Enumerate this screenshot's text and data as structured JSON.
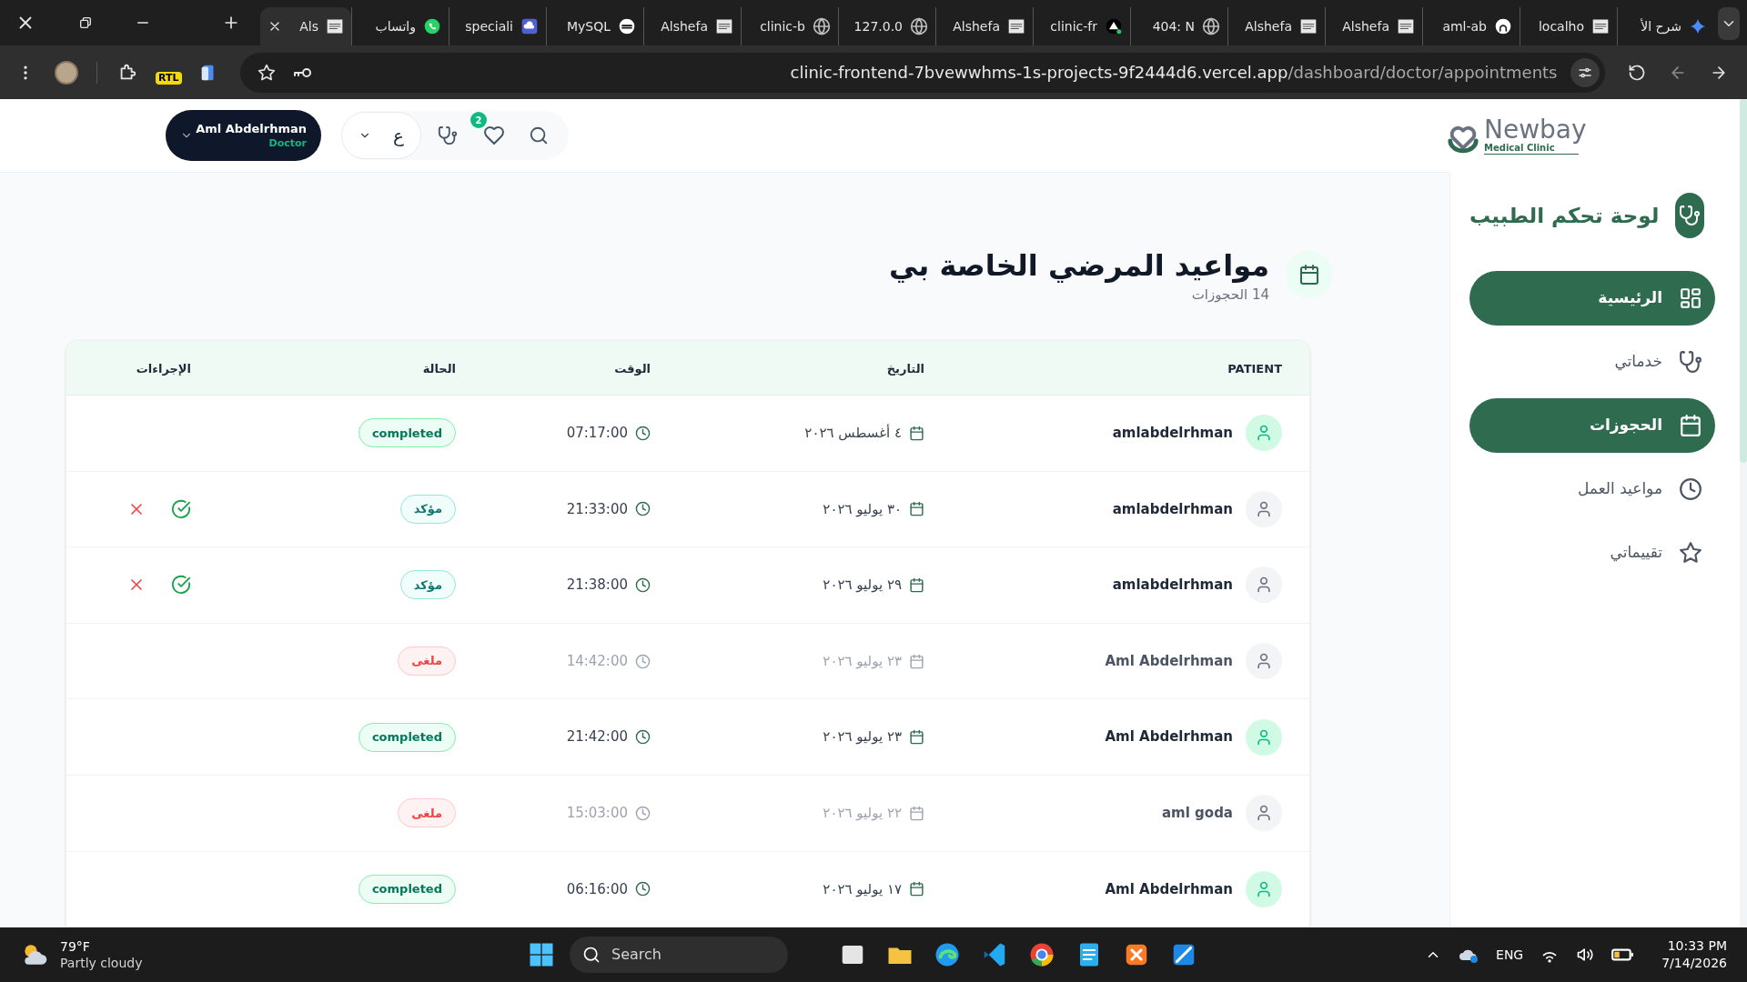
{
  "browser": {
    "tabs": [
      {
        "label": "شرح الأ",
        "selected": false
      },
      {
        "label": "localho",
        "selected": false
      },
      {
        "label": "aml-ab",
        "selected": false
      },
      {
        "label": "Alshefa",
        "selected": false
      },
      {
        "label": "Alshefa",
        "selected": false
      },
      {
        "label": "404: N",
        "selected": false
      },
      {
        "label": "clinic-fr",
        "selected": false
      },
      {
        "label": "Alshefa",
        "selected": false
      },
      {
        "label": "127.0.0",
        "selected": false
      },
      {
        "label": "clinic-b",
        "selected": false
      },
      {
        "label": "Alshefa",
        "selected": false
      },
      {
        "label": "MySQL",
        "selected": false
      },
      {
        "label": "speciali",
        "selected": false
      },
      {
        "label": "واتساب",
        "selected": false
      },
      {
        "label": "Als",
        "selected": true
      }
    ],
    "extension_badge": "RTL",
    "url": {
      "host": "clinic-frontend-7bvewwhms-1s-projects-9f2444d6.vercel.app",
      "path": "/dashboard/doctor/appointments"
    }
  },
  "header": {
    "logo": {
      "name": "Newbay",
      "tagline": "Medical Clinic"
    },
    "user": {
      "name": "Aml Abdelrhman",
      "role": "Doctor"
    },
    "language": "ع",
    "favorites_badge": "2"
  },
  "sidebar": {
    "title": "لوحة تحكم الطبيب",
    "items": [
      {
        "label": "الرئيسية",
        "selected": true
      },
      {
        "label": "خدماتي",
        "selected": false
      },
      {
        "label": "الحجوزات",
        "selected": true
      },
      {
        "label": "مواعيد العمل",
        "selected": false
      },
      {
        "label": "تقييماتي",
        "selected": false
      }
    ]
  },
  "page": {
    "title": "مواعيد المرضي الخاصة بي",
    "subtitle": "14 الحجوزات"
  },
  "table": {
    "columns": [
      "PATIENT",
      "التاريخ",
      "الوقت",
      "الحالة",
      "الإجراءات"
    ],
    "rows": [
      {
        "patient": "amlabdelrhman",
        "date": "٤ أغسطس ٢٠٢٦",
        "time": "07:17:00",
        "status": {
          "kind": "completed",
          "label": "completed"
        }
      },
      {
        "patient": "amlabdelrhman",
        "date": "٣٠ يوليو ٢٠٢٦",
        "time": "21:33:00",
        "status": {
          "kind": "confirmed",
          "label": "مؤكد"
        }
      },
      {
        "patient": "amlabdelrhman",
        "date": "٢٩ يوليو ٢٠٢٦",
        "time": "21:38:00",
        "status": {
          "kind": "confirmed",
          "label": "مؤكد"
        }
      },
      {
        "patient": "Aml Abdelrhman",
        "date": "٢٣ يوليو ٢٠٢٦",
        "time": "14:42:00",
        "status": {
          "kind": "cancelled",
          "label": "ملغى"
        }
      },
      {
        "patient": "Aml Abdelrhman",
        "date": "٢٣ يوليو ٢٠٢٦",
        "time": "21:42:00",
        "status": {
          "kind": "completed",
          "label": "completed"
        }
      },
      {
        "patient": "aml goda",
        "date": "٢٢ يوليو ٢٠٢٦",
        "time": "15:03:00",
        "status": {
          "kind": "cancelled",
          "label": "ملغى"
        }
      },
      {
        "patient": "Aml Abdelrhman",
        "date": "١٧ يوليو ٢٠٢٦",
        "time": "06:16:00",
        "status": {
          "kind": "completed",
          "label": "completed"
        }
      }
    ]
  },
  "taskbar": {
    "weather": {
      "temperature": "79°F",
      "condition": "Partly cloudy"
    },
    "search_placeholder": "Search",
    "language": "ENG",
    "time": "10:33 PM",
    "date": "7/14/2026"
  }
}
